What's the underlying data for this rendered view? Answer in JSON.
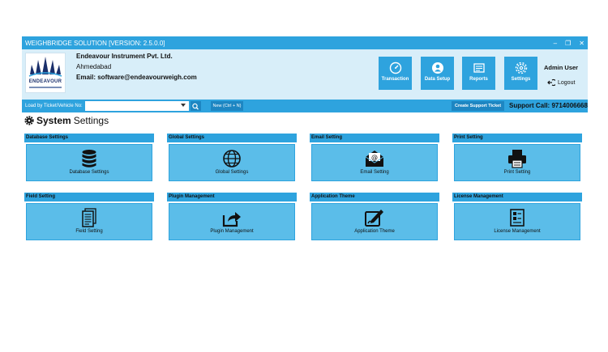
{
  "app": {
    "title": "WEIGHBRIDGE SOLUTION [VERSION: 2.5.0.0]",
    "window_controls": [
      "–",
      "❐",
      "✕"
    ]
  },
  "company": {
    "logo_word": "ENDEAVOUR",
    "name": "Endeavour Instrument Pvt. Ltd.",
    "city": "Ahmedabad",
    "email": "Email: software@endeavourweigh.com"
  },
  "nav": [
    {
      "label": "Transaction",
      "icon": "gauge-icon"
    },
    {
      "label": "Data Setup",
      "icon": "user-icon"
    },
    {
      "label": "Reports",
      "icon": "report-icon"
    },
    {
      "label": "Settings",
      "icon": "gear-icon"
    }
  ],
  "user": {
    "name": "Admin User",
    "logout_label": "Logout"
  },
  "search": {
    "label": "Load by Ticket/Vehicle No:",
    "value": "",
    "new_label": "New (Ctrl + N)",
    "support_label": "Create Support Ticket",
    "support_call": "Support Call: 9714006668"
  },
  "page": {
    "title_bold": "System",
    "title_rest": "Settings"
  },
  "cards": [
    {
      "title": "Database Settings",
      "label": "Database Settings",
      "icon": "database-icon"
    },
    {
      "title": "Global Settings",
      "label": "Global Settings",
      "icon": "globe-icon"
    },
    {
      "title": "Email Setting",
      "label": "Email Setting",
      "icon": "email-icon"
    },
    {
      "title": "Print Setting",
      "label": "Print Setting",
      "icon": "printer-icon"
    },
    {
      "title": "Field Setting",
      "label": "Field Setting",
      "icon": "document-icon"
    },
    {
      "title": "Plugin Management",
      "label": "Plugin Management",
      "icon": "share-icon"
    },
    {
      "title": "Application Theme",
      "label": "Application Theme",
      "icon": "theme-edit-icon"
    },
    {
      "title": "License Management",
      "label": "License Management",
      "icon": "license-icon"
    }
  ],
  "colors": {
    "accent": "#2ea3de",
    "card_body": "#5bbde9",
    "header_bg": "#d8eef9",
    "button_dark": "#1d86c2"
  }
}
